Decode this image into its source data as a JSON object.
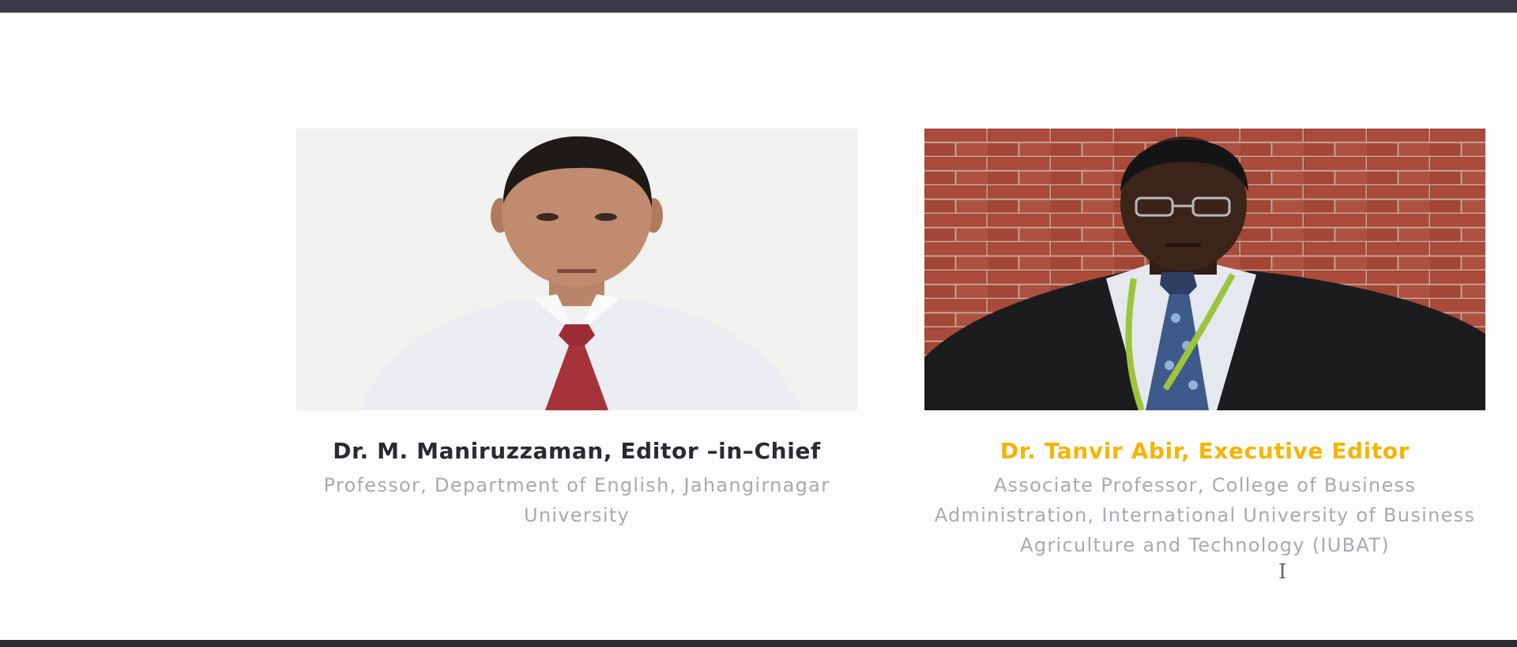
{
  "editors": [
    {
      "photo_icon": "portrait-photo",
      "name": "Dr. M. Maniruzzaman, Editor –in–Chief",
      "description": "Professor, Department of English, Jahangirnagar University",
      "name_color": "#2a2a32"
    },
    {
      "photo_icon": "portrait-photo",
      "name": "Dr. Tanvir Abir, Executive Editor",
      "description": "Associate Professor, College of Business Administration, International University of Business Agriculture and Technology (IUBAT)",
      "name_color": "#f6b400"
    }
  ],
  "cursor_icon": "text-cursor-icon"
}
